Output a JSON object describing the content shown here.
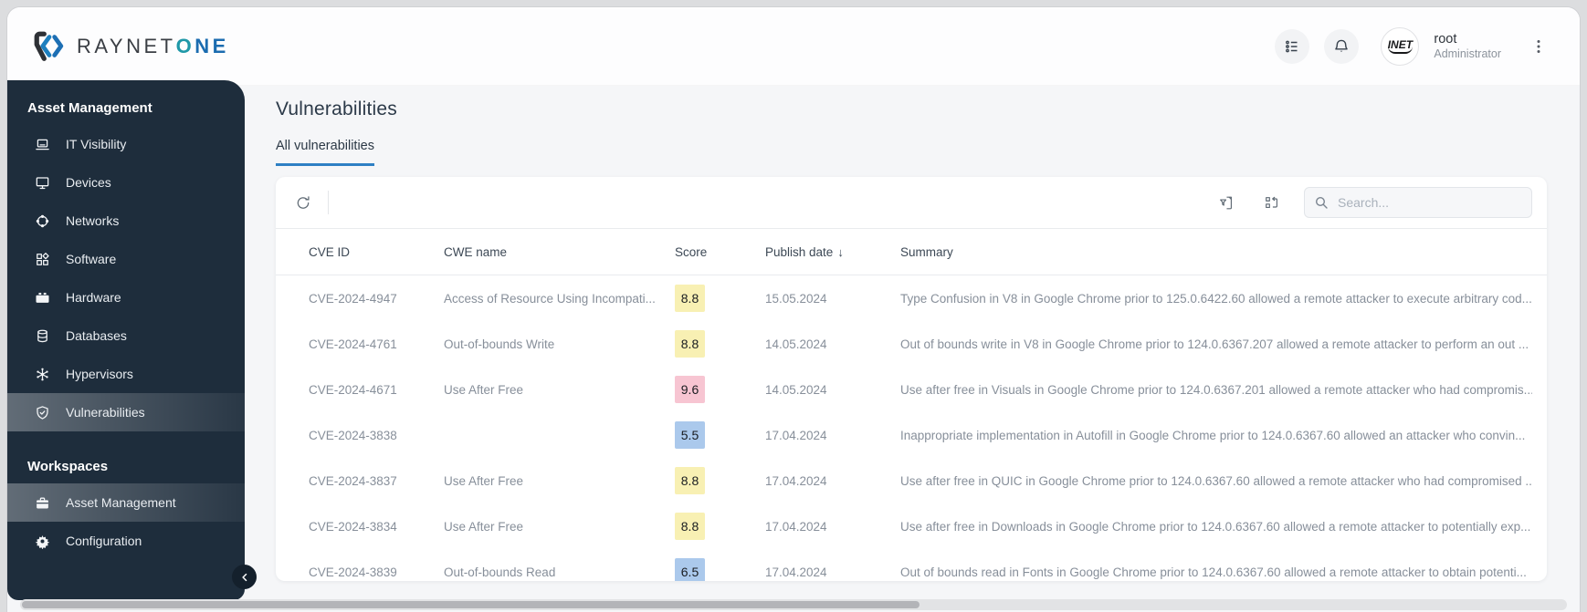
{
  "brand": {
    "name_primary": "RAYNET",
    "accent_o": "O",
    "accent_rest": "NE"
  },
  "topbar": {
    "user": {
      "name": "root",
      "role": "Administrator",
      "avatar_text": "INET"
    }
  },
  "sidebar": {
    "sections": [
      {
        "title": "Asset Management",
        "items": [
          {
            "label": "IT Visibility",
            "icon": "laptop-icon",
            "active": false
          },
          {
            "label": "Devices",
            "icon": "monitor-icon",
            "active": false
          },
          {
            "label": "Networks",
            "icon": "network-icon",
            "active": false
          },
          {
            "label": "Software",
            "icon": "software-icon",
            "active": false
          },
          {
            "label": "Hardware",
            "icon": "toolbox-icon",
            "active": false
          },
          {
            "label": "Databases",
            "icon": "database-icon",
            "active": false
          },
          {
            "label": "Hypervisors",
            "icon": "hypervisor-icon",
            "active": false
          },
          {
            "label": "Vulnerabilities",
            "icon": "shield-check-icon",
            "active": true
          }
        ]
      },
      {
        "title": "Workspaces",
        "items": [
          {
            "label": "Asset Management",
            "icon": "briefcase-icon",
            "active": true
          },
          {
            "label": "Configuration",
            "icon": "gear-icon",
            "active": false
          }
        ]
      }
    ]
  },
  "page": {
    "title": "Vulnerabilities",
    "tab": "All vulnerabilities"
  },
  "toolbar": {
    "search_placeholder": "Search..."
  },
  "table": {
    "columns": [
      "CVE ID",
      "CWE name",
      "Score",
      "Publish date",
      "Summary"
    ],
    "sort": {
      "column": "Publish date",
      "direction": "desc"
    },
    "rows": [
      {
        "cve": "CVE-2024-4947",
        "cwe": "Access of Resource Using Incompati...",
        "score": "8.8",
        "score_color": "#f8f0b3",
        "date": "15.05.2024",
        "summary": "Type Confusion in V8 in Google Chrome prior to 125.0.6422.60 allowed a remote attacker to execute arbitrary cod..."
      },
      {
        "cve": "CVE-2024-4761",
        "cwe": "Out-of-bounds Write",
        "score": "8.8",
        "score_color": "#f8f0b3",
        "date": "14.05.2024",
        "summary": "Out of bounds write in V8 in Google Chrome prior to 124.0.6367.207 allowed a remote attacker to perform an out ..."
      },
      {
        "cve": "CVE-2024-4671",
        "cwe": "Use After Free",
        "score": "9.6",
        "score_color": "#f7c5d2",
        "date": "14.05.2024",
        "summary": "Use after free in Visuals in Google Chrome prior to 124.0.6367.201 allowed a remote attacker who had compromis..."
      },
      {
        "cve": "CVE-2024-3838",
        "cwe": "",
        "score": "5.5",
        "score_color": "#abc9ec",
        "date": "17.04.2024",
        "summary": "Inappropriate implementation in Autofill in Google Chrome prior to 124.0.6367.60 allowed an attacker who convin..."
      },
      {
        "cve": "CVE-2024-3837",
        "cwe": "Use After Free",
        "score": "8.8",
        "score_color": "#f8f0b3",
        "date": "17.04.2024",
        "summary": "Use after free in QUIC in Google Chrome prior to 124.0.6367.60 allowed a remote attacker who had compromised ..."
      },
      {
        "cve": "CVE-2024-3834",
        "cwe": "Use After Free",
        "score": "8.8",
        "score_color": "#f8f0b3",
        "date": "17.04.2024",
        "summary": "Use after free in Downloads in Google Chrome prior to 124.0.6367.60 allowed a remote attacker to potentially exp..."
      },
      {
        "cve": "CVE-2024-3839",
        "cwe": "Out-of-bounds Read",
        "score": "6.5",
        "score_color": "#abc9ec",
        "date": "17.04.2024",
        "summary": "Out of bounds read in Fonts in Google Chrome prior to 124.0.6367.60 allowed a remote attacker to obtain potenti..."
      }
    ]
  },
  "colors": {
    "accent_blue": "#2e80c4",
    "sidebar_bg": "#1e2d3c",
    "badge_yellow": "#f8f0b3",
    "badge_red": "#f7c5d2",
    "badge_blue": "#abc9ec"
  }
}
